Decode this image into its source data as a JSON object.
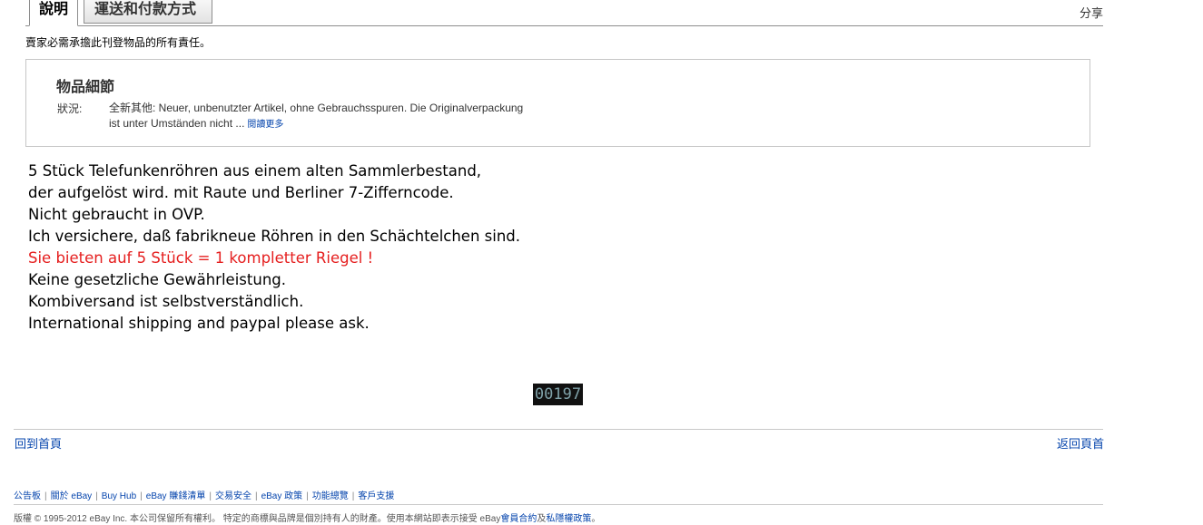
{
  "tabs": {
    "description": "說明",
    "shipping_payment": "運送和付款方式",
    "share": "分享"
  },
  "disclaimer": "賣家必需承擔此刊登物品的所有責任。",
  "item_details": {
    "title": "物品細節",
    "condition_label": "狀況:",
    "condition_line1": "全新其他: Neuer, unbenutzter Artikel, ohne Gebrauchsspuren. Die Originalverpackung",
    "condition_line2": "ist unter Umständen nicht ...",
    "read_more": "閱讀更多"
  },
  "description": {
    "line1": "5 Stück Telefunkenröhren aus einem alten Sammlerbestand,",
    "line2": "der aufgelöst wird. mit Raute und Berliner 7-Zifferncode.",
    "line3": "Nicht gebraucht in OVP.",
    "line4": "Ich versichere, daß fabrikneue Röhren in den Schächtelchen sind.",
    "line5_red": "Sie bieten auf 5 Stück = 1 kompletter Riegel !",
    "line6": "Keine gesetzliche Gewährleistung.",
    "line7": "Kombiversand ist selbstverständlich.",
    "line8": "International shipping and paypal please ask.",
    "highlight_color": "#e51e1e"
  },
  "counter": "00197",
  "nav": {
    "home_left": "回到首頁",
    "home_right": "返回頁首"
  },
  "footer": {
    "links": [
      "公告板",
      "關於 eBay",
      "Buy Hub",
      "eBay 賺錢清單",
      "交易安全",
      "eBay 政策",
      "功能總覽",
      "客戶支援"
    ],
    "copyright_text": "版權 © 1995-2012 eBay Inc. 本公司保留所有權利。 特定的商標與品牌是個別持有人的財產。使用本網站即表示接受 eBay",
    "user_agreement": "會員合約",
    "and": "及",
    "privacy": "私隱權政策",
    "period": "。"
  }
}
